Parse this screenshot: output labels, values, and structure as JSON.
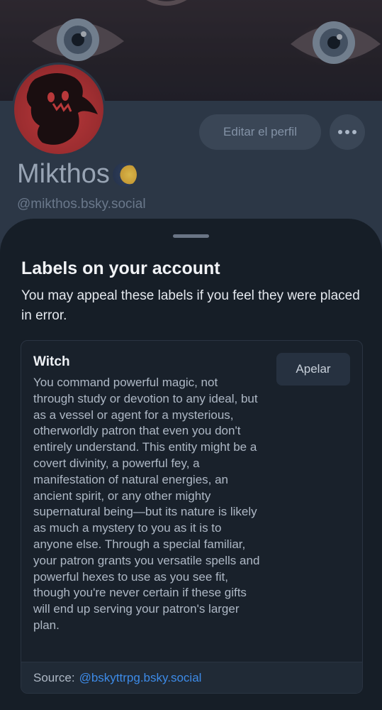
{
  "profile": {
    "display_name": "Mikthos",
    "handle": "@mikthos.bsky.social",
    "edit_label": "Editar el perfil"
  },
  "sheet": {
    "title": "Labels on your account",
    "subtitle": "You may appeal these labels if you feel they were placed in error.",
    "label": {
      "name": "Witch",
      "description": "You command powerful magic, not through study or devotion to any ideal, but as a vessel or agent for a mysterious, otherworldly patron that even you don't entirely understand. This entity might be a covert divinity, a powerful fey, a manifestation of natural energies, an ancient spirit, or any other mighty supernatural being—but its nature is likely as much a mystery to you as it is to anyone else. Through a special familiar, your patron grants you versatile spells and powerful hexes to use as you see fit, though you're never certain if these gifts will end up serving your patron's larger plan.",
      "appeal_label": "Apelar",
      "source_prefix": "Source:",
      "source_handle": "@bskyttrpg.bsky.social"
    }
  },
  "colors": {
    "sheet_bg": "#161e27",
    "link": "#3d8be8",
    "avatar_red": "#b8383a"
  },
  "icons": {
    "more": "more-horizontal-icon",
    "moon": "moon-emoji-icon"
  }
}
